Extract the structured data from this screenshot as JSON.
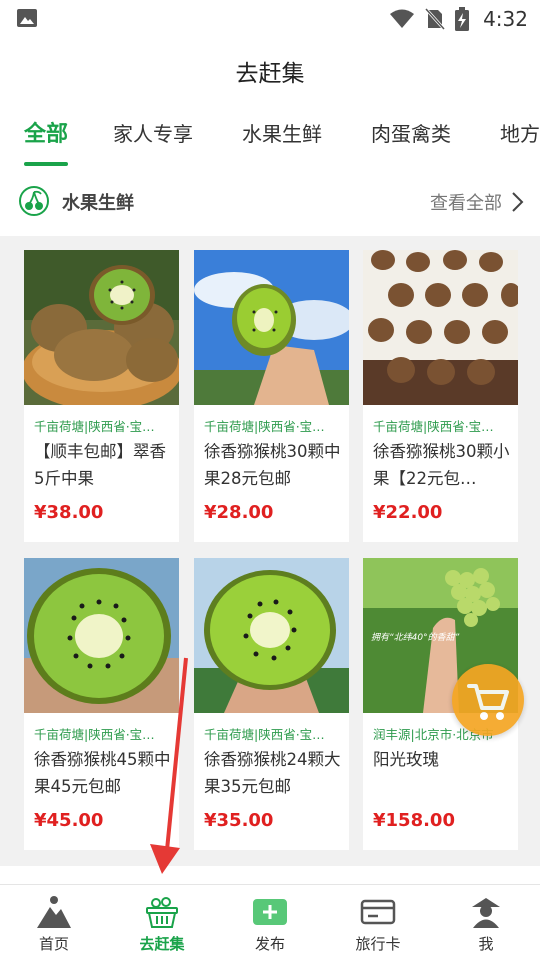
{
  "status_bar": {
    "time": "4:32"
  },
  "header": {
    "title": "去赶集"
  },
  "tabs": [
    {
      "label": "全部",
      "active": true
    },
    {
      "label": "家人专享",
      "active": false
    },
    {
      "label": "水果生鲜",
      "active": false
    },
    {
      "label": "肉蛋禽类",
      "active": false
    },
    {
      "label": "地方",
      "active": false
    }
  ],
  "section": {
    "title": "水果生鲜",
    "view_all": "查看全部"
  },
  "products": [
    {
      "origin": "千亩荷塘|陕西省·宝…",
      "name": "【顺丰包邮】翠香5斤中果",
      "price": "¥38.00"
    },
    {
      "origin": "千亩荷塘|陕西省·宝…",
      "name": "徐香猕猴桃30颗中果28元包邮",
      "price": "¥28.00"
    },
    {
      "origin": "千亩荷塘|陕西省·宝…",
      "name": "徐香猕猴桃30颗小果【22元包…",
      "price": "¥22.00"
    },
    {
      "origin": "千亩荷塘|陕西省·宝…",
      "name": "徐香猕猴桃45颗中果45元包邮",
      "price": "¥45.00"
    },
    {
      "origin": "千亩荷塘|陕西省·宝…",
      "name": "徐香猕猴桃24颗大果35元包邮",
      "price": "¥35.00"
    },
    {
      "origin": "润丰源|北京市·北京市",
      "name": "阳光玫瑰",
      "price": "¥158.00",
      "image_text": "拥有“北纬40°的香甜”"
    }
  ],
  "bottom_nav": [
    {
      "label": "首页",
      "icon": "home-mountain-icon",
      "active": false
    },
    {
      "label": "去赶集",
      "icon": "market-basket-icon",
      "active": true
    },
    {
      "label": "发布",
      "icon": "publish-plus-icon",
      "active": false
    },
    {
      "label": "旅行卡",
      "icon": "travel-card-icon",
      "active": false
    },
    {
      "label": "我",
      "icon": "profile-icon",
      "active": false
    }
  ],
  "colors": {
    "accent": "#1aa34a",
    "price": "#e02020",
    "cart": "#f5a623",
    "annotation_arrow": "#e53935"
  }
}
